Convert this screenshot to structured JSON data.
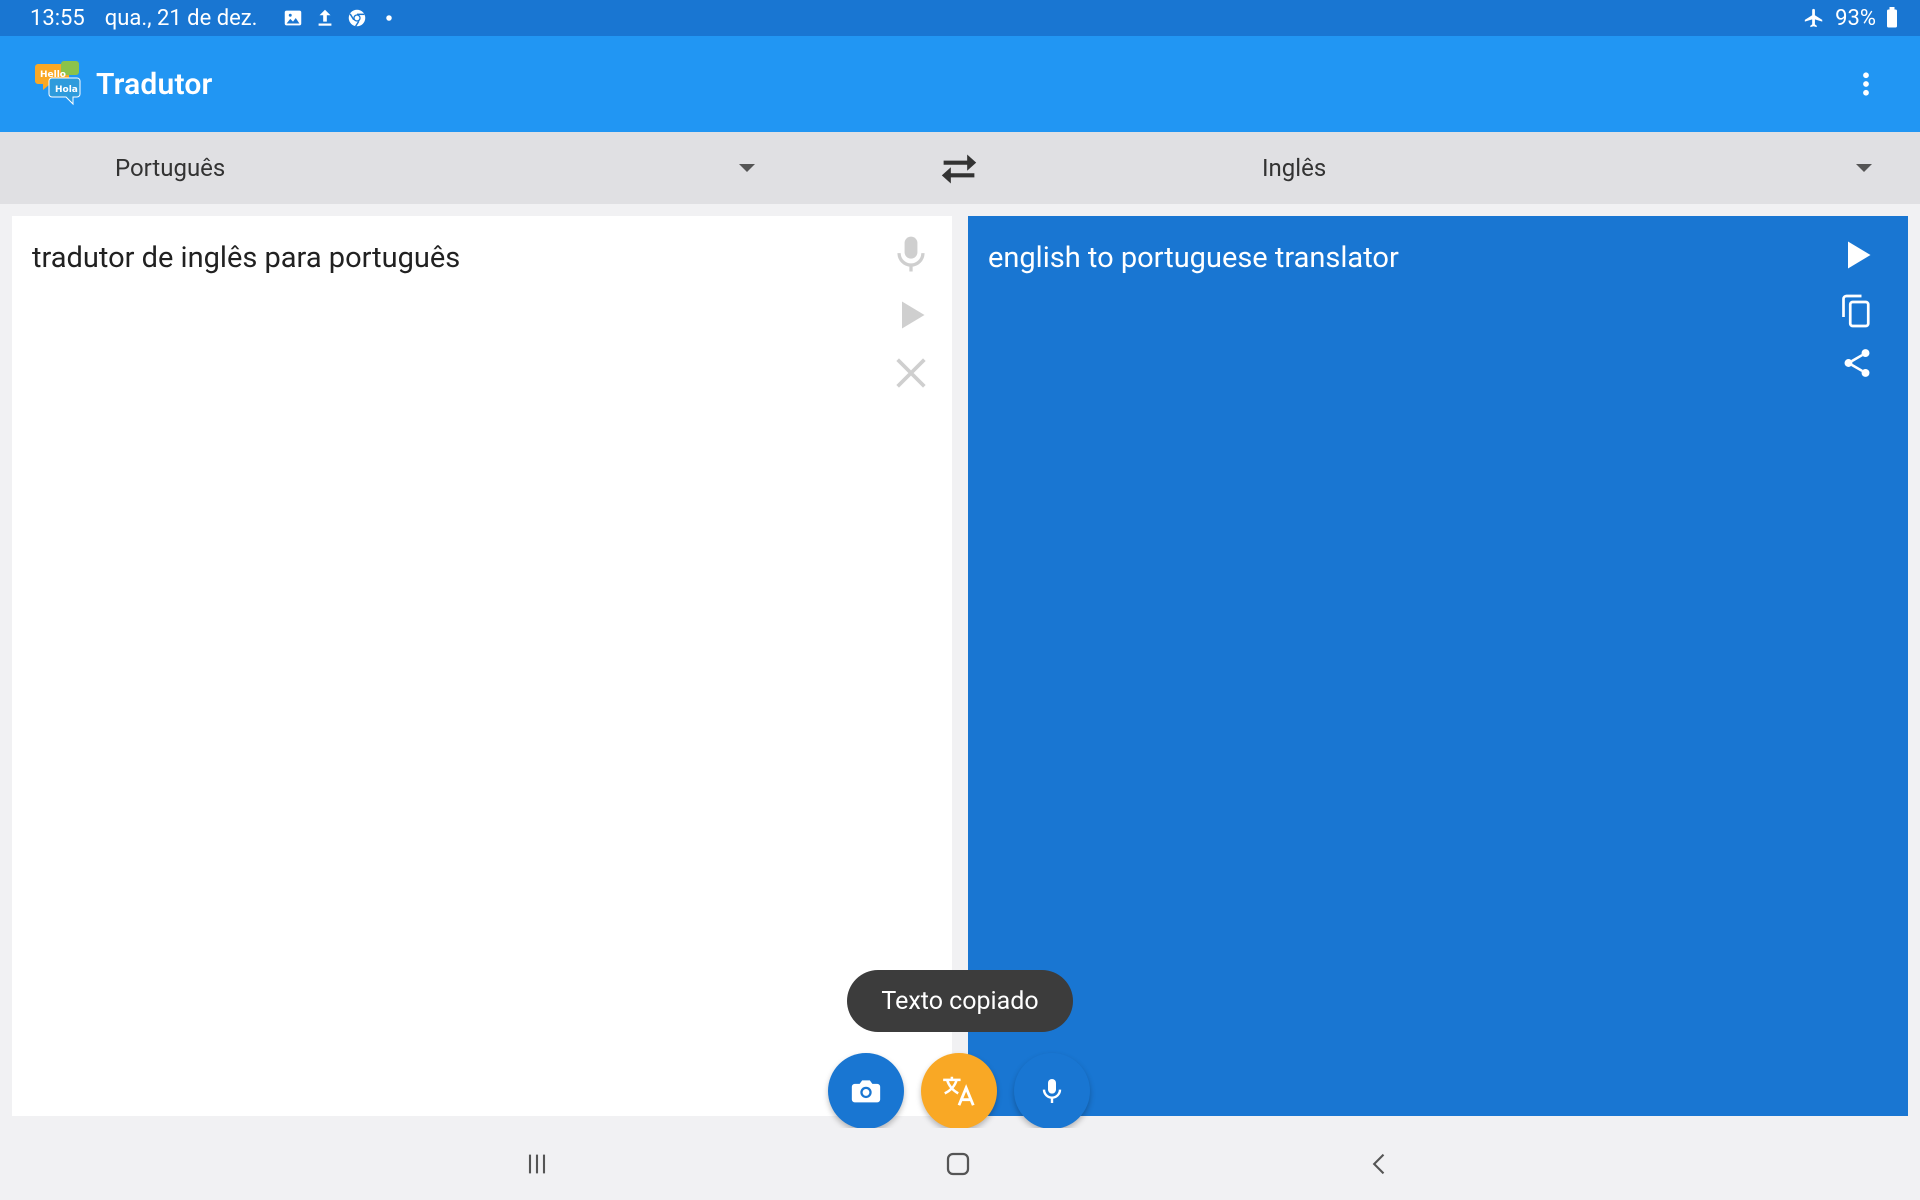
{
  "status_bar": {
    "time": "13:55",
    "date": "qua., 21 de dez.",
    "left_icons": [
      "gallery-icon",
      "upload-icon",
      "chrome-icon",
      "dot-icon"
    ],
    "battery": "93%",
    "right_icons": [
      "airplane-icon",
      "battery-icon"
    ]
  },
  "app_bar": {
    "title": "Tradutor",
    "logo_text_top": "Hello",
    "logo_text_bottom": "Hola"
  },
  "languages": {
    "source": "Português",
    "target": "Inglês"
  },
  "source_panel": {
    "text": "tradutor de inglês para português",
    "icons": [
      "microphone-icon",
      "play-icon",
      "close-icon"
    ]
  },
  "target_panel": {
    "text": "english to portuguese translator",
    "icons": [
      "play-icon",
      "copy-icon",
      "share-icon"
    ]
  },
  "toast": {
    "text": "Texto copiado"
  },
  "fabs": [
    "camera-icon",
    "translate-icon",
    "microphone-icon"
  ],
  "nav_bar": [
    "recent-apps-icon",
    "home-icon",
    "back-icon"
  ],
  "colors": {
    "status_bar": "#1976d2",
    "app_bar": "#2196f3",
    "target_panel": "#1976d2",
    "accent_orange": "#f9a825",
    "toast": "#3c3c3c"
  }
}
